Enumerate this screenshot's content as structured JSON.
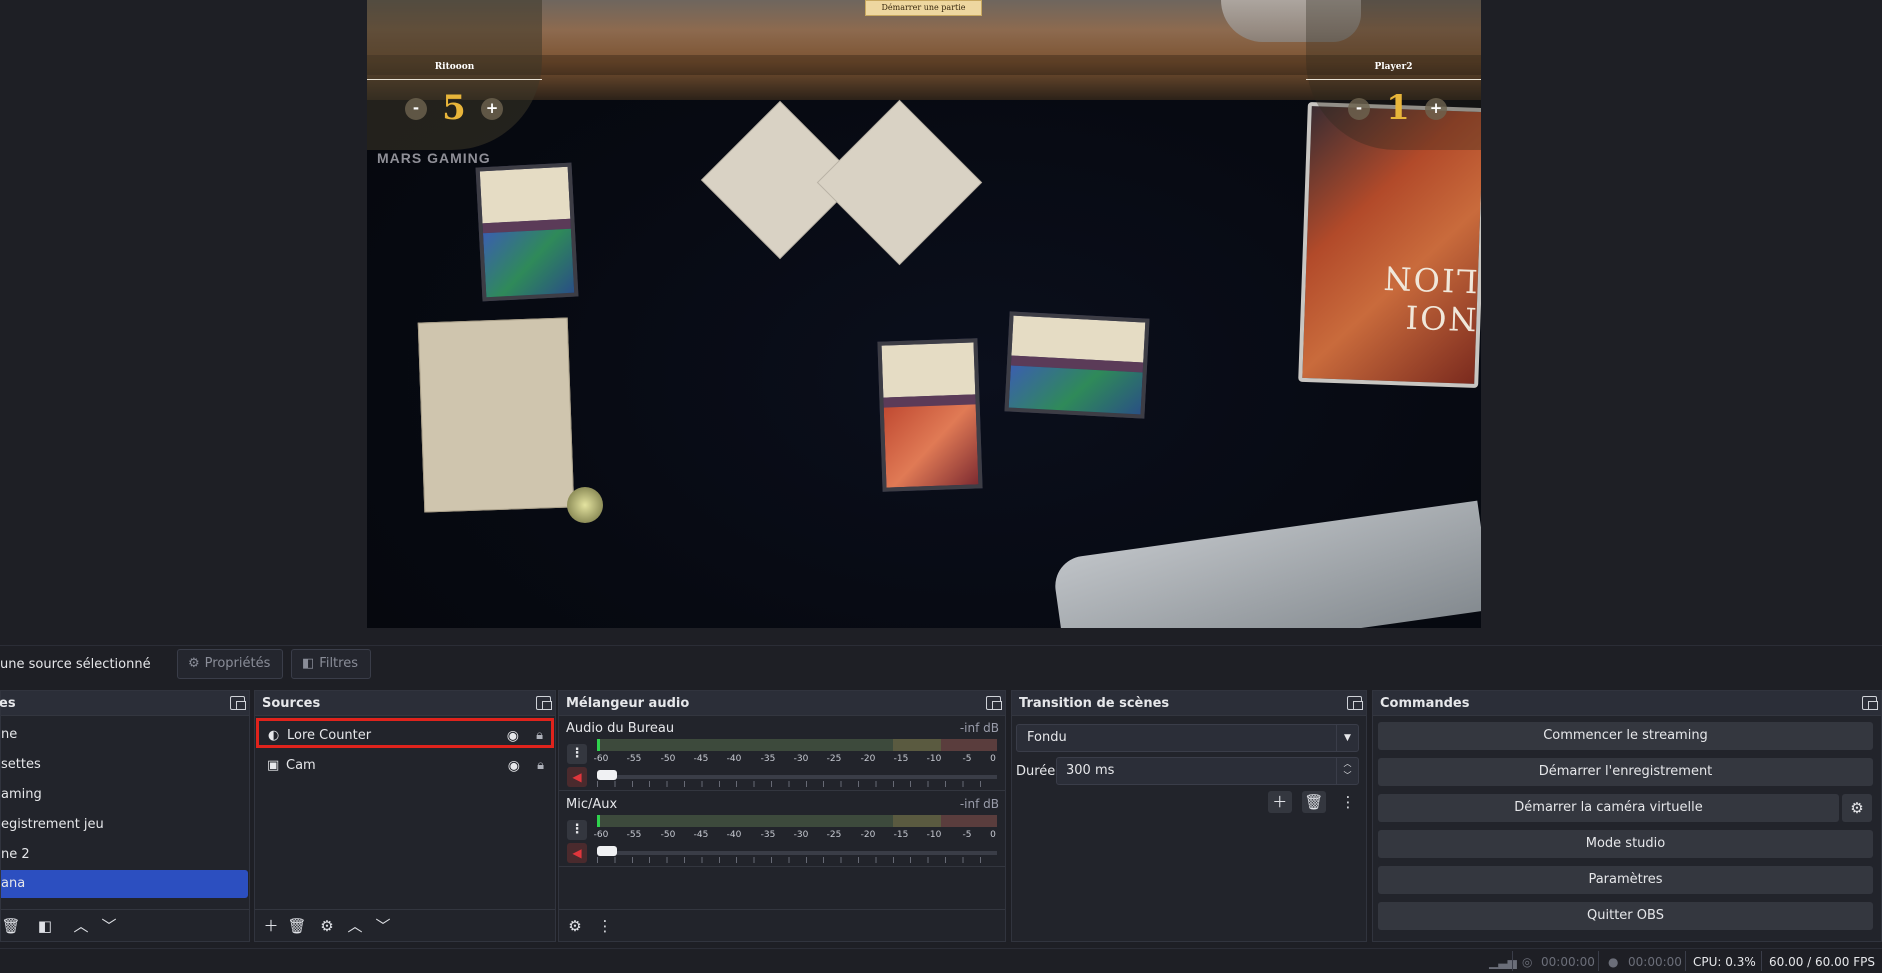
{
  "preview": {
    "overlay": {
      "start_button": "Démarrer une partie",
      "player1": {
        "name": "Ritooon",
        "lore": "5",
        "minus": "-",
        "plus": "+"
      },
      "player2": {
        "name": "Player2",
        "lore": "1",
        "minus": "-",
        "plus": "+"
      }
    },
    "webcam_branding": "MARS GAMING",
    "deck_text": "NOI LION"
  },
  "context_bar": {
    "selection_text": "une source sélectionné",
    "properties_label": "Propriétés",
    "filters_label": "Filtres"
  },
  "scenes": {
    "title": "es",
    "items": [
      {
        "label": "ne",
        "active": false
      },
      {
        "label": "settes",
        "active": false
      },
      {
        "label": "aming",
        "active": false
      },
      {
        "label": "egistrement jeu",
        "active": false
      },
      {
        "label": "ne 2",
        "active": false
      },
      {
        "label": "ana",
        "active": true
      }
    ]
  },
  "sources": {
    "title": "Sources",
    "items": [
      {
        "label": "Lore Counter",
        "icon": "globe-icon",
        "selected": true
      },
      {
        "label": "Cam",
        "icon": "camera-icon",
        "selected": false
      }
    ]
  },
  "mixer": {
    "title": "Mélangeur audio",
    "channels": [
      {
        "name": "Audio du Bureau",
        "db": "-inf dB"
      },
      {
        "name": "Mic/Aux",
        "db": "-inf dB"
      }
    ],
    "ticks": [
      "-60",
      "-55",
      "-50",
      "-45",
      "-40",
      "-35",
      "-30",
      "-25",
      "-20",
      "-15",
      "-10",
      "-5",
      "0"
    ]
  },
  "transition": {
    "title": "Transition de scènes",
    "type": "Fondu",
    "duration_label": "Durée",
    "duration_value": "300 ms"
  },
  "controls": {
    "title": "Commandes",
    "start_streaming": "Commencer le streaming",
    "start_recording": "Démarrer l'enregistrement",
    "start_virtual_cam": "Démarrer la caméra virtuelle",
    "studio_mode": "Mode studio",
    "settings": "Paramètres",
    "exit": "Quitter OBS"
  },
  "status": {
    "stream_time": "00:00:00",
    "record_time": "00:00:00",
    "cpu": "CPU: 0.3%",
    "fps": "60.00 / 60.00 FPS"
  },
  "colors": {
    "accent": "#2c4fc0",
    "highlight_border": "#e0231c",
    "meter_green": "#2fd24d",
    "lore_gold": "#e8b53a"
  }
}
